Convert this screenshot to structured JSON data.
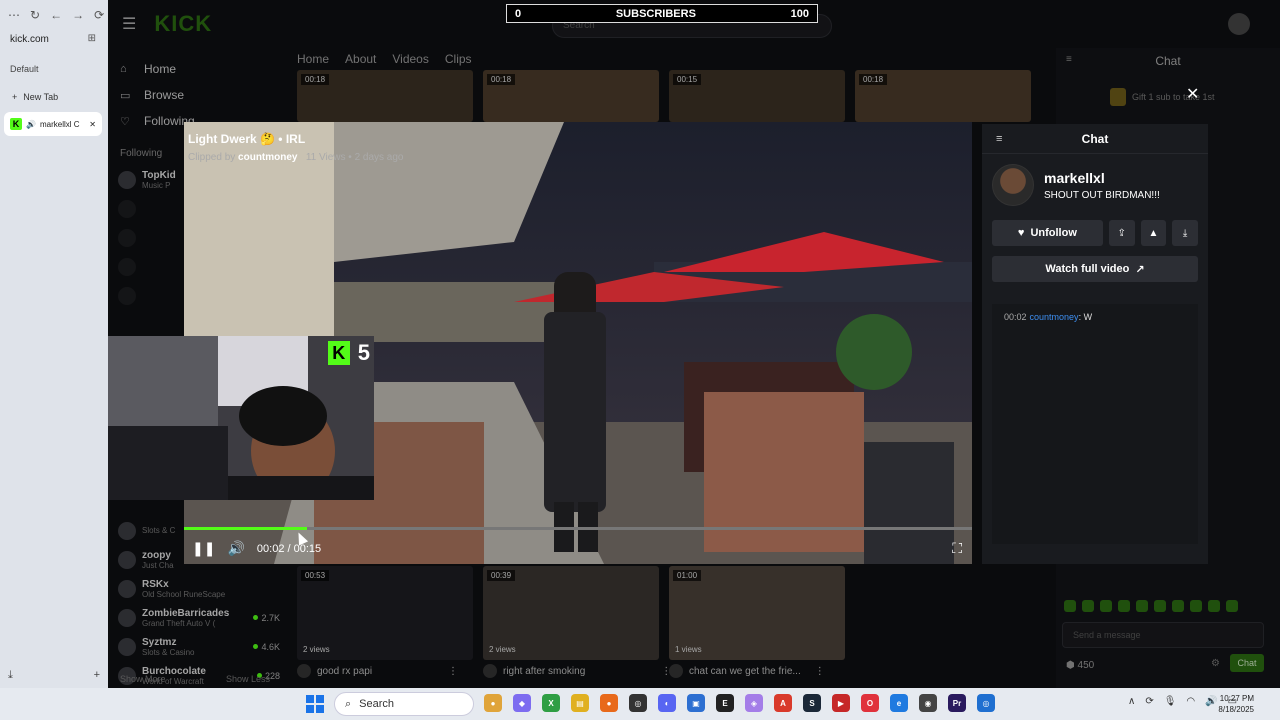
{
  "browser": {
    "url": "kick.com",
    "group_label": "Default",
    "new_tab_label": "New Tab",
    "active_tab_label": "markellxl C"
  },
  "subscribers": {
    "left": "0",
    "label": "SUBSCRIBERS",
    "right": "100"
  },
  "kick": {
    "search_placeholder": "Search",
    "nav": [
      {
        "label": "Home",
        "icon": "home-icon",
        "glyph": "⌂"
      },
      {
        "label": "Browse",
        "icon": "browse-icon",
        "glyph": "▭"
      },
      {
        "label": "Following",
        "icon": "heart-icon",
        "glyph": "♡"
      }
    ],
    "following_heading": "Following",
    "following_top": [
      {
        "name": "TopKid",
        "game": "Music P"
      },
      {
        "name": "",
        "game": ""
      },
      {
        "name": "",
        "game": ""
      },
      {
        "name": "",
        "game": ""
      },
      {
        "name": "",
        "game": ""
      }
    ],
    "show_more_hidden": "Show More",
    "following_bottom": [
      {
        "name": "",
        "game": "Slots & C",
        "count": ""
      },
      {
        "name": "zoopy",
        "game": "Just Cha",
        "count": ""
      },
      {
        "name": "RSKx",
        "game": "Old School RuneScape",
        "count": ""
      },
      {
        "name": "ZombieBarricades",
        "game": "Grand Theft Auto V (",
        "count": "2.7K"
      },
      {
        "name": "Syztmz",
        "game": "Slots & Casino",
        "count": "4.6K"
      },
      {
        "name": "Burchocolate",
        "game": "World of Warcraft",
        "count": "228"
      }
    ],
    "show_more": "Show More",
    "show_less": "Show Less",
    "tabs": [
      "Home",
      "About",
      "Videos",
      "Clips"
    ],
    "top_thumbs": [
      "00:18",
      "00:18",
      "00:15",
      "00:18"
    ],
    "bottom_clips": [
      {
        "duration": "00:53",
        "views": "2 views",
        "title": "good rx papi"
      },
      {
        "duration": "00:39",
        "views": "2 views",
        "title": "right after smoking"
      },
      {
        "duration": "01:00",
        "views": "1 views",
        "title": "chat can we get the frie..."
      }
    ],
    "bg_chat": {
      "title": "Chat",
      "gift_text": "Gift 1 sub to take 1st",
      "input_placeholder": "Send a message",
      "points": "450",
      "send_label": "Chat"
    }
  },
  "clip": {
    "title": "Light Dwerk 🤔 • IRL",
    "clipped_by_label": "Clipped by",
    "clipper": "countmoney",
    "views": "11 Views",
    "age": "2 days ago",
    "time_display": "00:02 / 00:15",
    "progress_fraction": 0.165
  },
  "panel": {
    "title": "Chat",
    "streamer": "markellxl",
    "description": "SHOUT OUT BIRDMAN!!!",
    "unfollow_label": "Unfollow",
    "watch_full_label": "Watch full video",
    "messages": [
      {
        "time": "00:02",
        "user": "countmoney",
        "text": "W"
      }
    ]
  },
  "webcam": {
    "sub_goal_number": "5"
  },
  "taskbar": {
    "search_label": "Search",
    "time": "10:27 PM",
    "date": "8/18/2025",
    "apps": [
      {
        "name": "balloons-icon",
        "color": "#e0a43a",
        "glyph": "●"
      },
      {
        "name": "copilot-icon",
        "color": "#7d6cf0",
        "glyph": "◆"
      },
      {
        "name": "xbox-icon",
        "color": "#2f9e44",
        "glyph": "X"
      },
      {
        "name": "file-explorer-icon",
        "color": "#e0b020",
        "glyph": "▤"
      },
      {
        "name": "firefox-icon",
        "color": "#e8691a",
        "glyph": "●"
      },
      {
        "name": "obs-icon",
        "color": "#333333",
        "glyph": "◎"
      },
      {
        "name": "discord-icon",
        "color": "#5865f2",
        "glyph": "◐"
      },
      {
        "name": "photos-icon",
        "color": "#2d6fd1",
        "glyph": "▣"
      },
      {
        "name": "epic-icon",
        "color": "#222222",
        "glyph": "E"
      },
      {
        "name": "app-icon",
        "color": "#a47de8",
        "glyph": "◈"
      },
      {
        "name": "adobe-icon",
        "color": "#d93a2b",
        "glyph": "A"
      },
      {
        "name": "steam-icon",
        "color": "#1b2838",
        "glyph": "S"
      },
      {
        "name": "capcut-icon",
        "color": "#c62828",
        "glyph": "▶"
      },
      {
        "name": "opera-icon",
        "color": "#e0323c",
        "glyph": "O"
      },
      {
        "name": "edge-icon",
        "color": "#1f7ae0",
        "glyph": "e"
      },
      {
        "name": "chrome-icon",
        "color": "#444444",
        "glyph": "◉"
      },
      {
        "name": "premiere-icon",
        "color": "#2a1a5e",
        "glyph": "Pr"
      },
      {
        "name": "browser-icon",
        "color": "#1f6fd0",
        "glyph": "◎"
      }
    ]
  }
}
